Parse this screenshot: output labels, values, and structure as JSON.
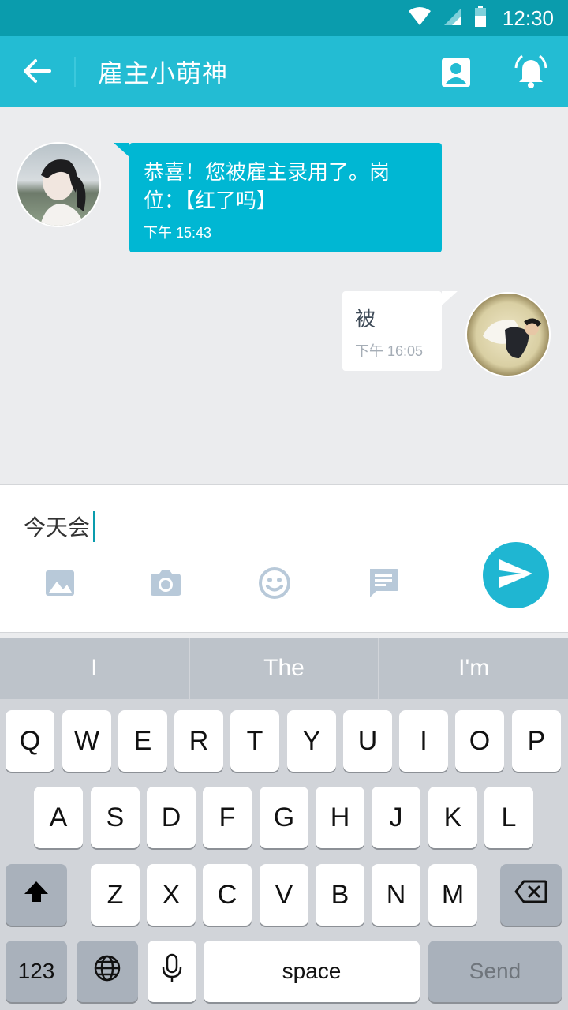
{
  "status_bar": {
    "time": "12:30"
  },
  "header": {
    "title": "雇主小萌神"
  },
  "messages": [
    {
      "side": "left",
      "text_line1": "恭喜！您被雇主录用了。岗",
      "text_line2": "位：【红了吗】",
      "time": "下午 15:43"
    },
    {
      "side": "right",
      "text": "被",
      "time": "下午 16:05"
    }
  ],
  "composer": {
    "text": "今天会"
  },
  "keyboard": {
    "suggestions": [
      "I",
      "The",
      "I'm"
    ],
    "row1": [
      "Q",
      "W",
      "E",
      "R",
      "T",
      "Y",
      "U",
      "I",
      "O",
      "P"
    ],
    "row2": [
      "A",
      "S",
      "D",
      "F",
      "G",
      "H",
      "J",
      "K",
      "L"
    ],
    "row3": [
      "Z",
      "X",
      "C",
      "V",
      "B",
      "N",
      "M"
    ],
    "numbers_label": "123",
    "space_label": "space",
    "send_label": "Send"
  },
  "colors": {
    "accent": "#23bcd3",
    "status_bar": "#0a9cad",
    "bubble_in": "#00b7d3"
  }
}
